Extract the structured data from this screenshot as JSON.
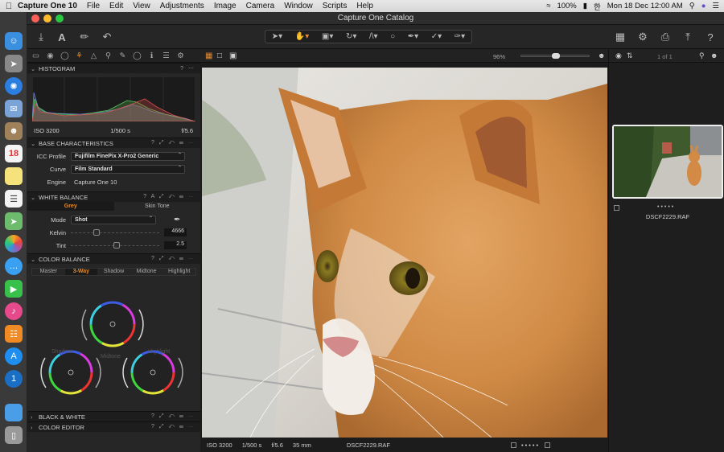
{
  "menubar": {
    "app_name": "Capture One 10",
    "menus": [
      "File",
      "Edit",
      "View",
      "Adjustments",
      "Image",
      "Camera",
      "Window",
      "Scripts",
      "Help"
    ],
    "battery": "100%",
    "input_source": "한",
    "datetime": "Mon 18 Dec  12:00 AM"
  },
  "window": {
    "title": "Capture One Catalog"
  },
  "left_panel": {
    "histogram": {
      "title": "HISTOGRAM",
      "iso": "ISO 3200",
      "shutter": "1/500 s",
      "aperture": "f/5.6"
    },
    "base_characteristics": {
      "title": "BASE CHARACTERISTICS",
      "icc_label": "ICC Profile",
      "icc_value": "Fujifilm FinePix X-Pro2 Generic",
      "curve_label": "Curve",
      "curve_value": "Film Standard",
      "engine_label": "Engine",
      "engine_value": "Capture One 10"
    },
    "white_balance": {
      "title": "WHITE BALANCE",
      "tabs": [
        "Grey",
        "Skin Tone"
      ],
      "mode_label": "Mode",
      "mode_value": "Shot",
      "kelvin_label": "Kelvin",
      "kelvin_value": "4666",
      "kelvin_level": 0.27,
      "tint_label": "Tint",
      "tint_value": "2.5",
      "tint_level": 0.52
    },
    "color_balance": {
      "title": "COLOR BALANCE",
      "tabs": [
        "Master",
        "3-Way",
        "Shadow",
        "Midtone",
        "Highlight"
      ],
      "active_tab": "3-Way",
      "wheel_labels": {
        "shadow": "Shadow",
        "midtone": "Midtone",
        "highlight": "Highlight"
      }
    },
    "black_white": {
      "title": "BLACK & WHITE"
    },
    "color_editor": {
      "title": "COLOR EDITOR"
    }
  },
  "viewer": {
    "zoom": "96%",
    "iso": "ISO 3200",
    "shutter": "1/500 s",
    "aperture": "f/5.6",
    "focal": "35 mm",
    "filename": "DSCF2229.RAF"
  },
  "browser": {
    "count": "1 of 1",
    "filename": "DSCF2229.RAF"
  },
  "colors": {
    "accent": "#e48a2f"
  }
}
